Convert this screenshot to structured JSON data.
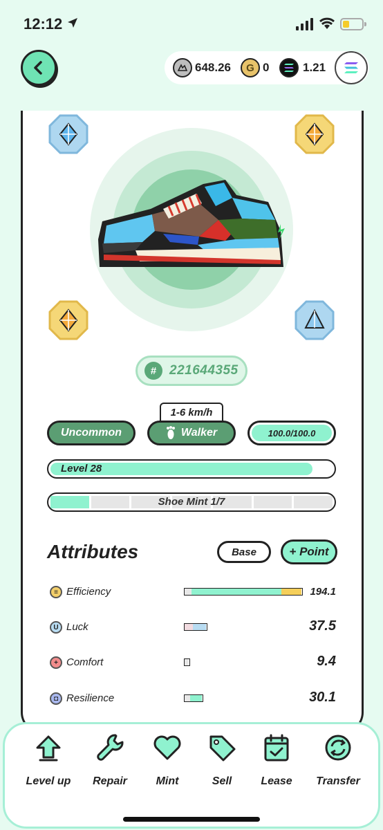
{
  "status_bar": {
    "time": "12:12"
  },
  "wallet": {
    "gst": "648.26",
    "gmt": "0",
    "sol": "1.21",
    "gmt_symbol": "G"
  },
  "shoe": {
    "id": "221644355",
    "speed_range": "1-6 km/h",
    "rarity": "Uncommon",
    "type": "Walker",
    "durability": "100.0/100.0",
    "level_label": "Level 28",
    "level_progress": 0.93,
    "mint_label": "Shoe Mint 1/7",
    "mint_count": 1,
    "mint_total": 7
  },
  "attributes": {
    "title": "Attributes",
    "base_button": "Base",
    "point_button": "+ Point",
    "rows": [
      {
        "name": "Efficiency",
        "value": "194.1",
        "icon_name": "efficiency-icon",
        "icon_color": "#f3cf6a"
      },
      {
        "name": "Luck",
        "value": "37.5",
        "icon_name": "luck-icon",
        "icon_color": "#b8dcf2"
      },
      {
        "name": "Comfort",
        "value": "9.4",
        "icon_name": "comfort-icon",
        "icon_color": "#f28c8c"
      },
      {
        "name": "Resilience",
        "value": "30.1",
        "icon_name": "resilience-icon",
        "icon_color": "#a9b8ef"
      }
    ]
  },
  "toolbar": {
    "level_up": "Level up",
    "repair": "Repair",
    "mint": "Mint",
    "sell": "Sell",
    "lease": "Lease",
    "transfer": "Transfer"
  },
  "colors": {
    "accent": "#8ff2cf",
    "rarity_green": "#5b9e73",
    "background": "#e6fbf1"
  }
}
